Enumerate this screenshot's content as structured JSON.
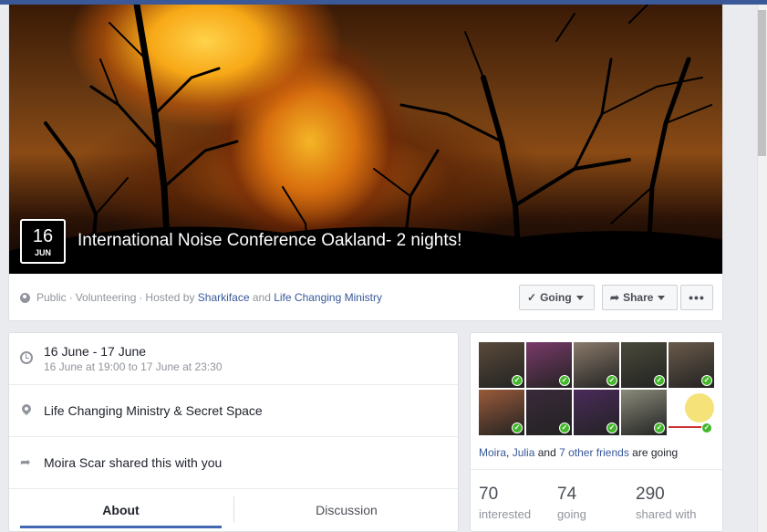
{
  "event": {
    "date_day": "16",
    "date_month": "JUN",
    "title": "International Noise Conference Oakland- 2 nights!"
  },
  "meta": {
    "visibility": "Public",
    "sep1": "·",
    "category": "Volunteering",
    "sep2": "·",
    "hosted_by_prefix": "Hosted by",
    "host1": "Sharkiface",
    "and": "and",
    "host2": "Life Changing Ministry"
  },
  "actions": {
    "going_label": "Going",
    "going_icon": "check-icon",
    "share_label": "Share",
    "share_icon": "share-arrow-icon",
    "more_label": "•••"
  },
  "details": {
    "time_main": "16 June - 17 June",
    "time_sub": "16 June at 19:00 to 17 June at 23:30",
    "place": "Life Changing Ministry & Secret Space",
    "shared": "Moira Scar shared this with you"
  },
  "tabs": {
    "about": "About",
    "discussion": "Discussion"
  },
  "friends": {
    "name1": "Moira",
    "comma": ",",
    "name2": "Julia",
    "and": "and",
    "others": "7 other friends",
    "suffix": "are going",
    "avatar_colors": [
      "#5a4a3a",
      "#7a3a6a",
      "#8a7a6a",
      "#4a4a3a",
      "#6a5a4a",
      "#9a5a3a",
      "#3a2a3a",
      "#4a2a5a",
      "#8a8a7a",
      "#f5e37a"
    ]
  },
  "stats": {
    "interested_num": "70",
    "interested_label": "interested",
    "going_num": "74",
    "going_label": "going",
    "shared_num": "290",
    "shared_label": "shared with"
  },
  "colors": {
    "link": "#365899",
    "accent": "#4267b2",
    "check_green": "#42b72a"
  }
}
